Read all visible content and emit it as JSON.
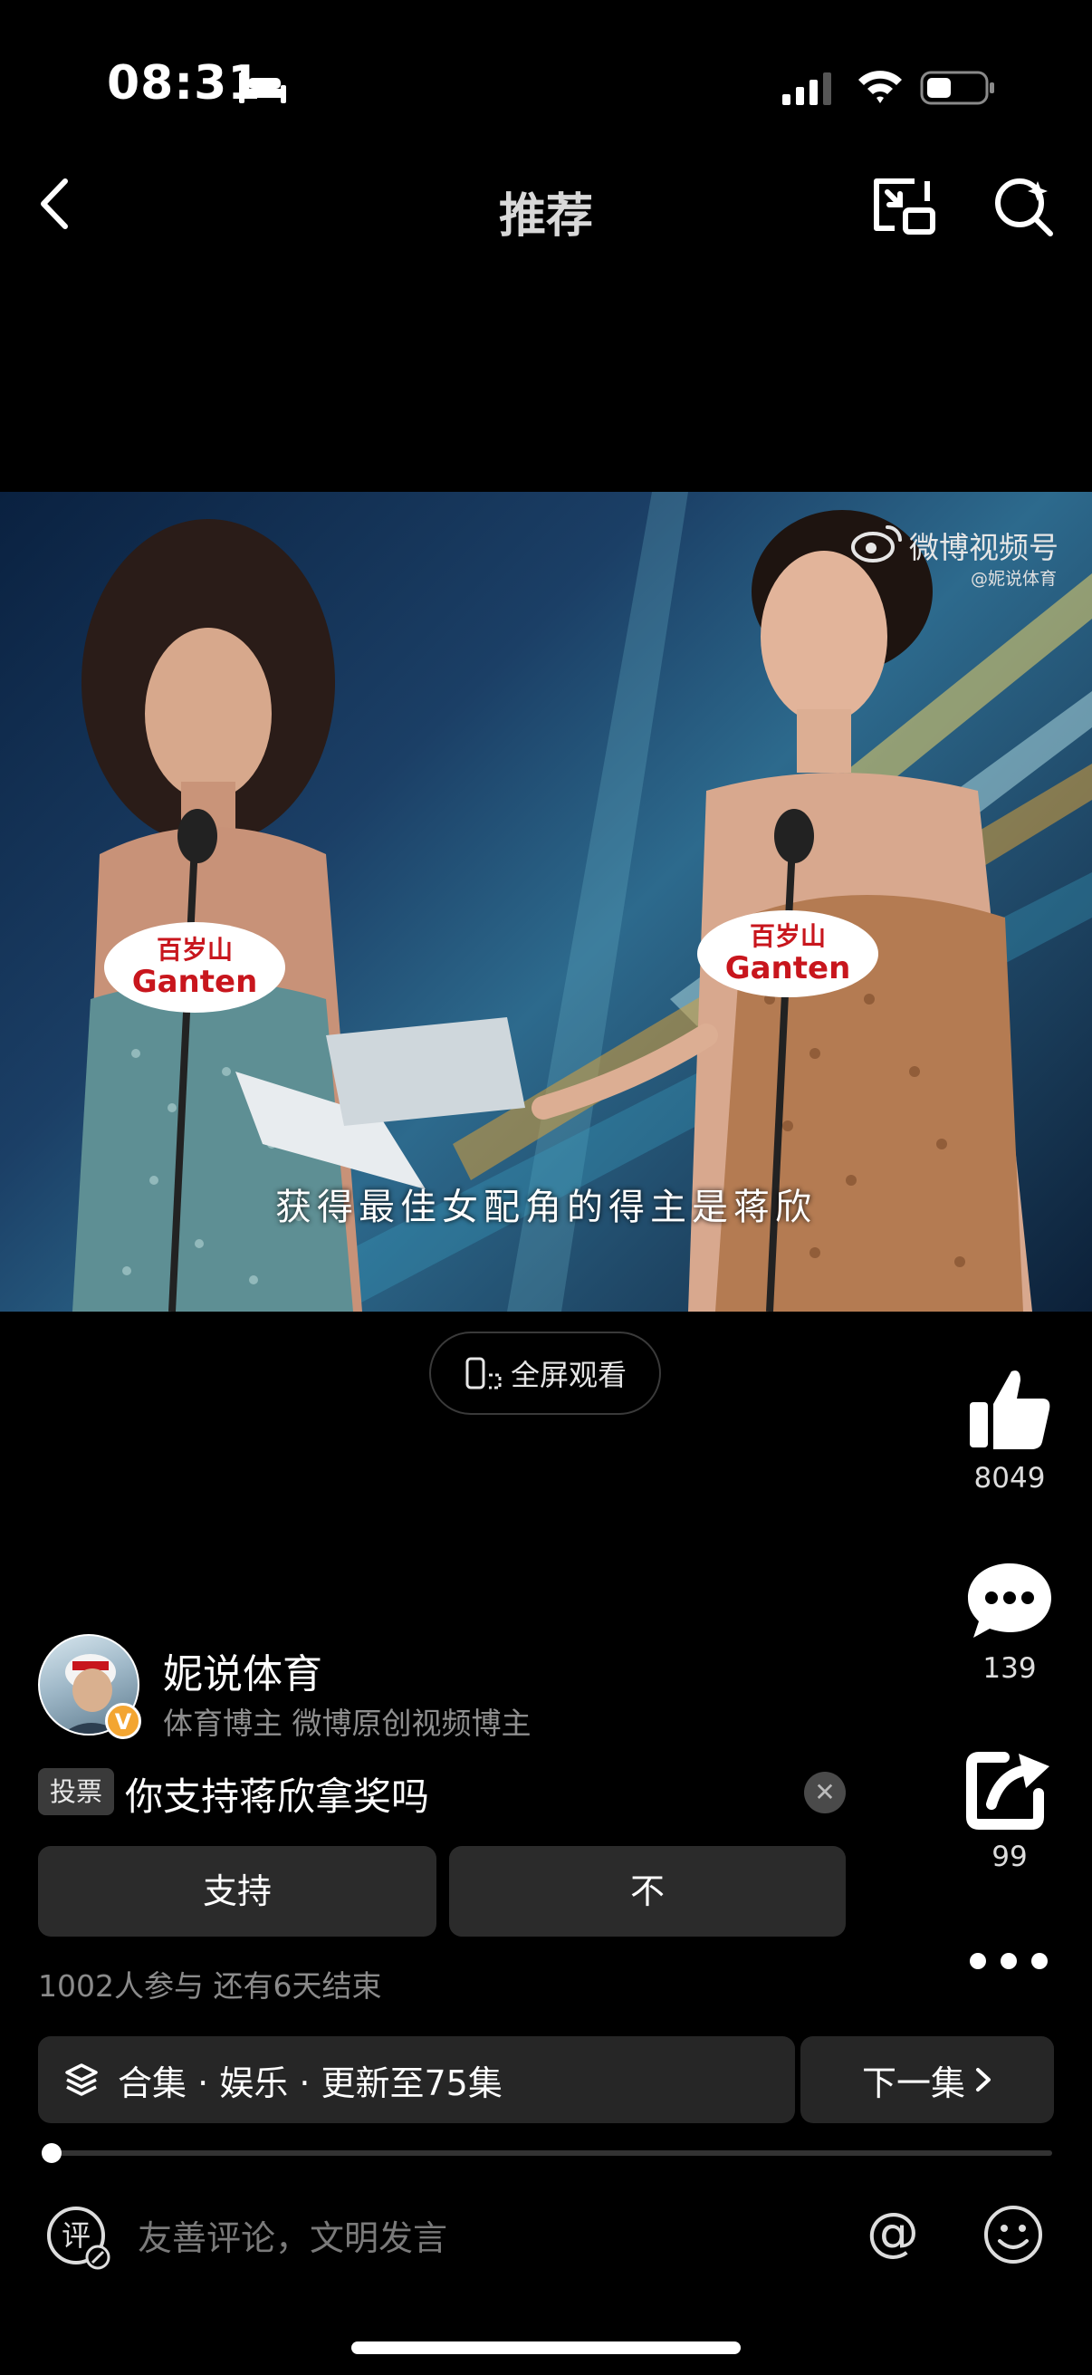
{
  "status_bar": {
    "time": "08:31"
  },
  "header": {
    "title": "推荐"
  },
  "video": {
    "subtitle": "获得最佳女配角的得主是蒋欣",
    "watermark": "微博视频号",
    "watermark_handle": "@妮说体育",
    "podium_brand_top": "百岁山",
    "podium_brand_bottom": "Ganten"
  },
  "fullscreen": {
    "label": "全屏观看"
  },
  "actions": {
    "like_count": "8049",
    "comment_count": "139",
    "share_count": "99"
  },
  "author": {
    "name": "妮说体育",
    "description": "体育博主 微博原创视频博主",
    "badge": "V"
  },
  "vote": {
    "tag": "投票",
    "question": "你支持蒋欣拿奖吗",
    "options": [
      "支持",
      "不"
    ],
    "meta": "1002人参与  还有6天结束"
  },
  "collection": {
    "label": "合集 · 娱乐 · 更新至75集",
    "next_label": "下一集"
  },
  "progress": {
    "fraction": 0.002
  },
  "comment": {
    "placeholder": "友善评论，文明发言"
  },
  "colors": {
    "background": "#000000",
    "button": "#2b2b2b",
    "muted_text": "#8e8e8e"
  }
}
